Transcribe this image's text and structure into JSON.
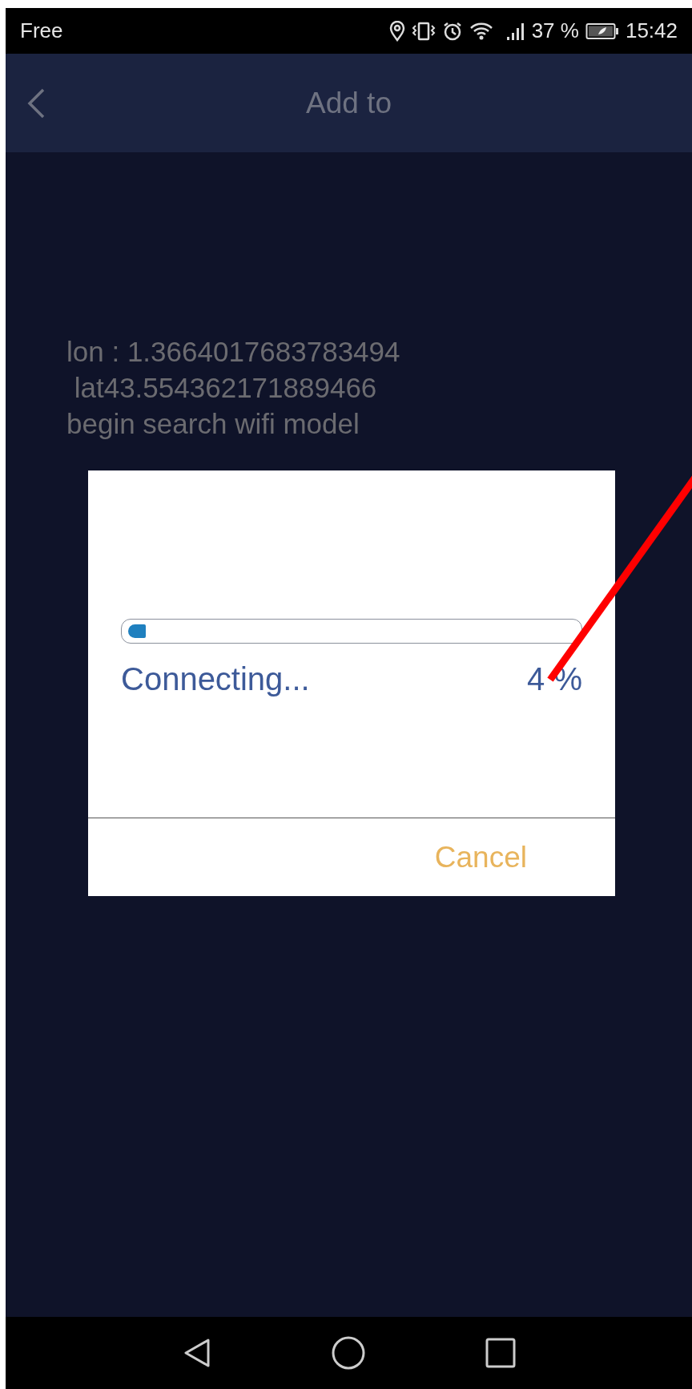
{
  "status_bar": {
    "carrier": "Free",
    "battery_percent": "37 %",
    "time": "15:42"
  },
  "app_bar": {
    "title": "Add to"
  },
  "log_lines": [
    "lon : 1.3664017683783494",
    " lat43.554362171889466",
    "begin search wifi model"
  ],
  "dialog": {
    "progress": {
      "level": 0.04,
      "label": "Connecting...",
      "percent": "4 %"
    },
    "buttons": [
      "Cancel"
    ]
  }
}
